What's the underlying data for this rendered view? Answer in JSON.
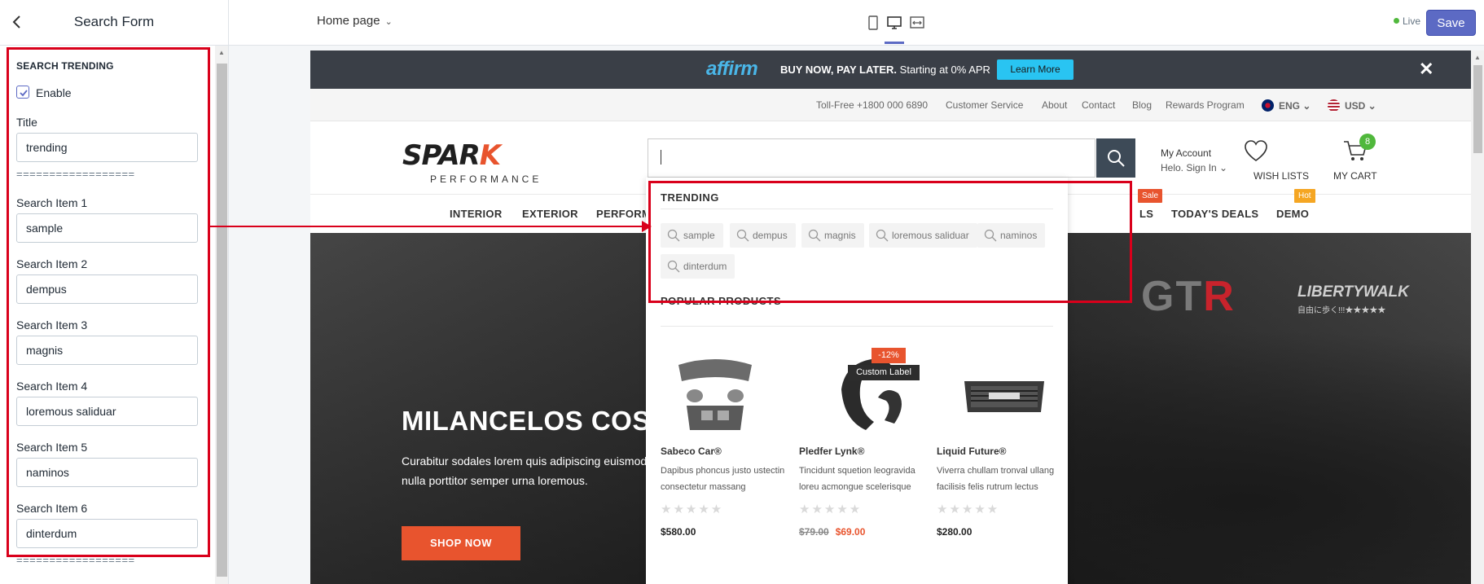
{
  "editor": {
    "panel_title": "Search Form",
    "page_selector": "Home page",
    "status": "Live",
    "save_label": "Save"
  },
  "sidebar": {
    "section_heading": "SEARCH TRENDING",
    "enable_label": "Enable",
    "enable_checked": true,
    "title_label": "Title",
    "title_value": "trending",
    "separator": "==================",
    "items": [
      {
        "label": "Search Item 1",
        "value": "sample"
      },
      {
        "label": "Search Item 2",
        "value": "dempus"
      },
      {
        "label": "Search Item 3",
        "value": "magnis"
      },
      {
        "label": "Search Item 4",
        "value": "loremous saliduar"
      },
      {
        "label": "Search Item 5",
        "value": "naminos"
      },
      {
        "label": "Search Item 6",
        "value": "dinterdum"
      }
    ]
  },
  "store": {
    "promo": {
      "brand": "affirm",
      "headline": "BUY NOW, PAY LATER.",
      "subtext": "Starting at 0% APR",
      "button": "Learn More"
    },
    "util_links": [
      "Toll-Free +1800 000 6890",
      "Customer Service",
      "About",
      "Contact",
      "Blog",
      "Rewards Program"
    ],
    "language": "ENG",
    "currency": "USD",
    "logo_text": "SPARK",
    "logo_sub": "PERFORMANCE",
    "account_title": "My Account",
    "account_sub": "Helo. Sign In",
    "wishlist_label": "WISH LISTS",
    "cart_label": "MY CART",
    "cart_count": "8",
    "nav": [
      "INTERIOR",
      "EXTERIOR",
      "PERFORM",
      "LS",
      "TODAY'S DEALS",
      "DEMO"
    ],
    "nav_tags": {
      "sale": "Sale",
      "hot": "Hot"
    },
    "hero": {
      "title": "MILANCELOS COSMO",
      "text": "Curabitur sodales lorem quis adipiscing euismod nulla porttitor semper urna loremous.",
      "button": "SHOP NOW",
      "brand_mark": "GTR",
      "brand2": "LIBERTYWALK",
      "brand2_sub": "自由に歩く!!!★★★★★"
    }
  },
  "dropdown": {
    "trending_heading": "TRENDING",
    "trending": [
      "sample",
      "dempus",
      "magnis",
      "loremous saliduar",
      "naminos",
      "dinterdum"
    ],
    "popular_heading": "POPULAR PRODUCTS",
    "products": [
      {
        "name": "Sabeco Car®",
        "desc": "Dapibus phoncus justo ustectin consectetur massang",
        "price": "$580.00"
      },
      {
        "name": "Pledfer Lynk®",
        "desc": "Tincidunt squetion leogravida loreu acmongue scelerisque",
        "old_price": "$79.00",
        "price": "$69.00",
        "discount": "-12%",
        "custom_label": "Custom Label"
      },
      {
        "name": "Liquid Future®",
        "desc": "Viverra chullam tronval ullang facilisis felis rutrum lectus",
        "price": "$280.00"
      }
    ],
    "stars": "★★★★★"
  }
}
